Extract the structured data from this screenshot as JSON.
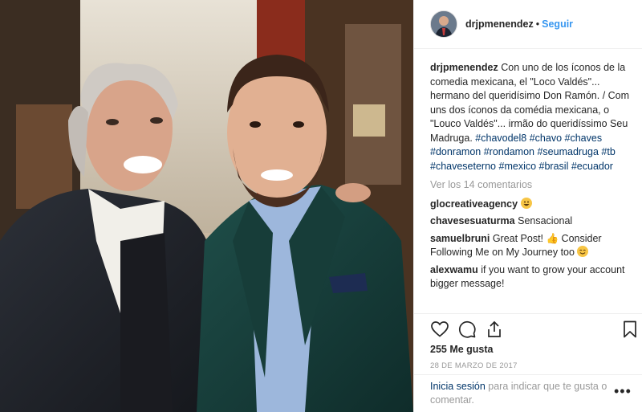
{
  "post": {
    "username": "drjpmenendez",
    "dot": "•",
    "follow_label": "Seguir",
    "caption_username": "drjpmenendez",
    "caption_text": "Con uno de los íconos de la comedia mexicana, el \"Loco Valdés\"... hermano del queridísimo Don Ramón. / Com uns dos íconos da comédia mexicana, o \"Louco Valdés\"... irmão do queridíssimo Seu Madruga.",
    "hashtags": [
      "#chavodel8",
      "#chavo",
      "#chaves",
      "#donramon",
      "#rondamon",
      "#seumadruga",
      "#tb",
      "#chaveseterno",
      "#mexico",
      "#brasil",
      "#ecuador"
    ],
    "view_comments": "Ver los 14 comentarios",
    "comments": [
      {
        "user": "glocreativeagency",
        "text": "",
        "emoji": "grinning-emoji"
      },
      {
        "user": "chavesesuaturma",
        "text": "Sensacional",
        "emoji": ""
      },
      {
        "user": "samuelbruni",
        "text": "Great Post! 👍 Consider Following Me on My Journey too",
        "emoji": "smile-emoji"
      },
      {
        "user": "alexwamu",
        "text": "if you want to grow your account bigger message!",
        "emoji": ""
      }
    ],
    "likes": "255 Me gusta",
    "date": "28 DE MARZO DE 2017",
    "login_link": "Inicia sesión",
    "login_text": "para indicar que te gusta o comentar.",
    "more_label": "•••",
    "icons": [
      "heart-icon",
      "comment-icon",
      "share-icon",
      "bookmark-icon",
      "more-options-icon"
    ],
    "colors": {
      "link_blue": "#3897f0",
      "hashtag": "#003569",
      "muted": "#999999",
      "text": "#262626"
    }
  }
}
